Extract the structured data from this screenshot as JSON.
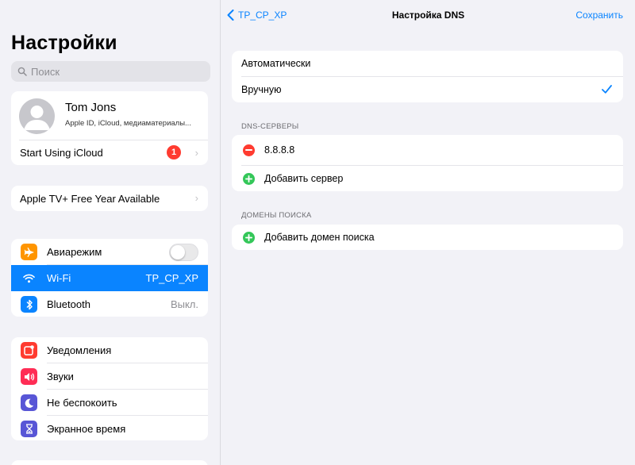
{
  "sidebar": {
    "title": "Настройки",
    "search": {
      "placeholder": "Поиск"
    },
    "profile": {
      "name": "Tom Jons",
      "subtitle": "Apple ID, iCloud, медиаматериалы...",
      "icloud_label": "Start Using iCloud",
      "icloud_badge": "1"
    },
    "apple_tv": {
      "label": "Apple TV+ Free Year Available"
    },
    "connectivity": [
      {
        "label": "Авиарежим",
        "icon": "airplane-icon",
        "color": "#ff9500",
        "toggle": false
      },
      {
        "label": "Wi-Fi",
        "icon": "wifi-icon",
        "color": "#0a84ff",
        "value": "TP_CP_XP",
        "selected": true
      },
      {
        "label": "Bluetooth",
        "icon": "bluetooth-icon",
        "color": "#0a84ff",
        "value": "Выкл."
      }
    ],
    "notifications": [
      {
        "label": "Уведомления",
        "icon": "notifications-icon",
        "color": "#ff3b30"
      },
      {
        "label": "Звуки",
        "icon": "sounds-icon",
        "color": "#ff2d55"
      },
      {
        "label": "Не беспокоить",
        "icon": "moon-icon",
        "color": "#5856d6"
      },
      {
        "label": "Экранное время",
        "icon": "hourglass-icon",
        "color": "#5856d6"
      }
    ]
  },
  "main": {
    "nav": {
      "back_label": "TP_CP_XP",
      "title": "Настройка DNS",
      "save_label": "Сохранить"
    },
    "mode": {
      "options": [
        {
          "label": "Автоматически",
          "selected": false
        },
        {
          "label": "Вручную",
          "selected": true
        }
      ]
    },
    "dns_section": {
      "header": "DNS-СЕРВЕРЫ",
      "servers": [
        "8.8.8.8"
      ],
      "add_label": "Добавить сервер"
    },
    "search_domains": {
      "header": "ДОМЕНЫ ПОИСКА",
      "add_label": "Добавить домен поиска"
    }
  },
  "colors": {
    "accent": "#0a84ff",
    "badge": "#ff3b30",
    "add": "#34c759",
    "remove": "#ff3b30"
  }
}
